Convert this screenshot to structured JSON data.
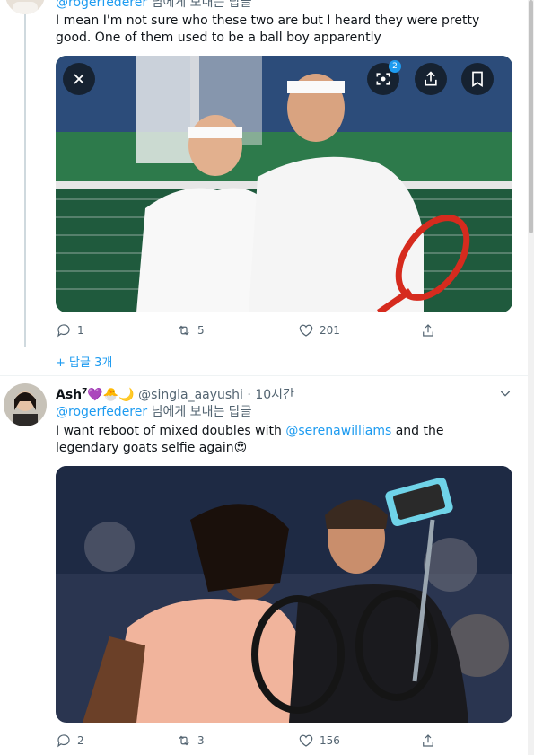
{
  "tweet1": {
    "reply_to_handle": "@rogerfederer",
    "reply_to_suffix": "님에게 보내는 답글",
    "text": "I mean I'm not sure who these two are but I heard they were pretty good. One of them used to be a ball boy apparently",
    "media_badge": "2",
    "replies": "1",
    "retweets": "5",
    "likes": "201",
    "show_replies": "+ 답글 3개"
  },
  "tweet2": {
    "display_name": "Ash",
    "name_sup": "7",
    "name_emojis": "💜🐣🌙",
    "handle": "@singla_aayushi",
    "dot": "·",
    "time": "10시간",
    "reply_to_handle": "@rogerfederer",
    "reply_to_suffix": "님에게 보내는 답글",
    "text_before": "I want reboot of mixed doubles with ",
    "mention": "@serenawilliams",
    "text_after": " and the legendary goats selfie again😍",
    "replies": "2",
    "retweets": "3",
    "likes": "156"
  },
  "colors": {
    "accent": "#1d9bf0",
    "muted": "#536471",
    "divider": "#eff3f4"
  },
  "icons": [
    "close-icon",
    "scan-icon",
    "share-icon",
    "bookmark-icon",
    "reply-icon",
    "retweet-icon",
    "like-icon",
    "share-icon",
    "chevron-down-icon"
  ]
}
